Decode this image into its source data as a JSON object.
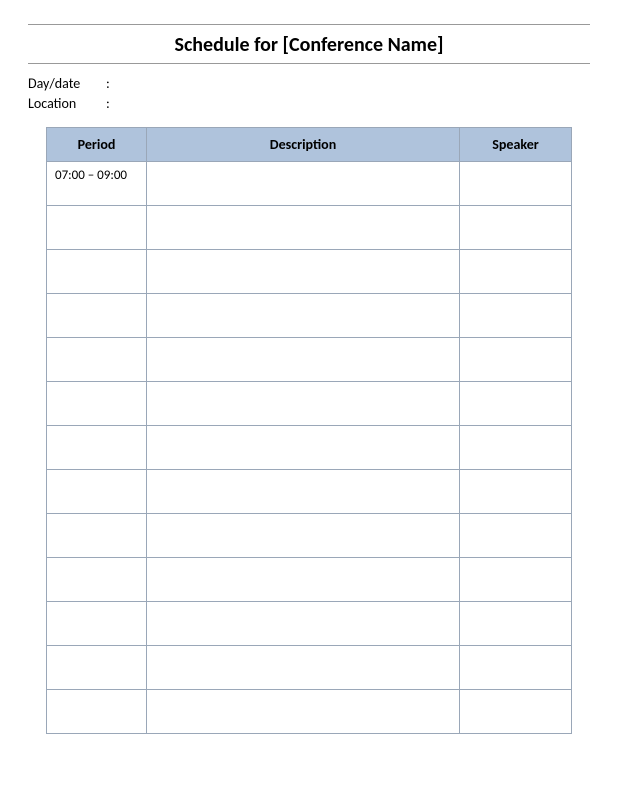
{
  "title": "Schedule for [Conference Name]",
  "meta": {
    "daydate_label": "Day/date",
    "daydate_value": "",
    "location_label": "Location",
    "location_value": "",
    "colon": ":"
  },
  "table": {
    "headers": {
      "period": "Period",
      "description": "Description",
      "speaker": "Speaker"
    },
    "rows": [
      {
        "period": "07:00 – 09:00",
        "description": "",
        "speaker": ""
      },
      {
        "period": "",
        "description": "",
        "speaker": ""
      },
      {
        "period": "",
        "description": "",
        "speaker": ""
      },
      {
        "period": "",
        "description": "",
        "speaker": ""
      },
      {
        "period": "",
        "description": "",
        "speaker": ""
      },
      {
        "period": "",
        "description": "",
        "speaker": ""
      },
      {
        "period": "",
        "description": "",
        "speaker": ""
      },
      {
        "period": "",
        "description": "",
        "speaker": ""
      },
      {
        "period": "",
        "description": "",
        "speaker": ""
      },
      {
        "period": "",
        "description": "",
        "speaker": ""
      },
      {
        "period": "",
        "description": "",
        "speaker": ""
      },
      {
        "period": "",
        "description": "",
        "speaker": ""
      },
      {
        "period": "",
        "description": "",
        "speaker": ""
      }
    ]
  }
}
